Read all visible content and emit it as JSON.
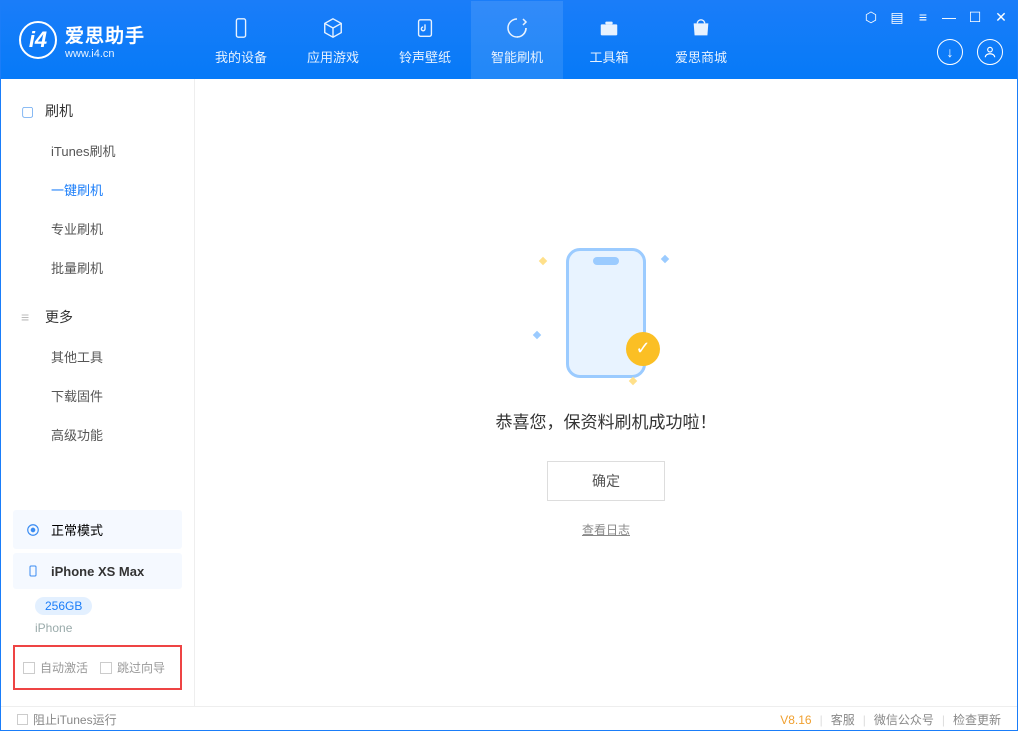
{
  "brand": {
    "title": "爱思助手",
    "sub": "www.i4.cn"
  },
  "nav": {
    "items": [
      {
        "label": "我的设备"
      },
      {
        "label": "应用游戏"
      },
      {
        "label": "铃声壁纸"
      },
      {
        "label": "智能刷机"
      },
      {
        "label": "工具箱"
      },
      {
        "label": "爱思商城"
      }
    ],
    "activeIndex": 3
  },
  "sidebar": {
    "sections": [
      {
        "header": "刷机",
        "items": [
          "iTunes刷机",
          "一键刷机",
          "专业刷机",
          "批量刷机"
        ],
        "activeIndex": 1
      },
      {
        "header": "更多",
        "items": [
          "其他工具",
          "下载固件",
          "高级功能"
        ],
        "activeIndex": -1
      }
    ],
    "mode": {
      "label": "正常模式"
    },
    "device": {
      "name": "iPhone XS Max",
      "capacity": "256GB",
      "type": "iPhone"
    },
    "checks": {
      "autoActivate": "自动激活",
      "skipGuide": "跳过向导"
    }
  },
  "main": {
    "successText": "恭喜您，保资料刷机成功啦！",
    "okButton": "确定",
    "logLink": "查看日志"
  },
  "footer": {
    "blockItunes": "阻止iTunes运行",
    "version": "V8.16",
    "links": {
      "kefu": "客服",
      "wechat": "微信公众号",
      "update": "检查更新"
    }
  },
  "colors": {
    "primary": "#1a7df9",
    "accent": "#fbbf24"
  }
}
